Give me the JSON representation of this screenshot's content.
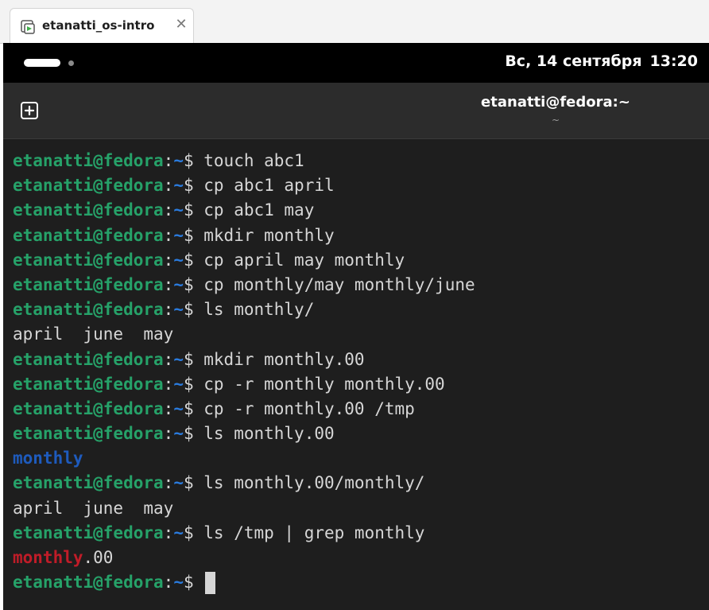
{
  "window": {
    "tab_title": "etanatti_os-intro",
    "tab_close_glyph": "✕",
    "tab_icon": "terminal-app-icon"
  },
  "topbar": {
    "clock": {
      "date": "Вс, 14 сентября",
      "time": "13:20"
    }
  },
  "headerbar": {
    "title": "etanatti@fedora:~",
    "subtitle": "~",
    "new_tab_icon": "plus-box-icon"
  },
  "prompt": {
    "user_host": "etanatti@fedora",
    "colon": ":",
    "path": "~",
    "symbol": "$ "
  },
  "terminal": {
    "lines": [
      {
        "type": "cmd",
        "text": "touch abc1"
      },
      {
        "type": "cmd",
        "text": "cp abc1 april"
      },
      {
        "type": "cmd",
        "text": "cp abc1 may"
      },
      {
        "type": "cmd",
        "text": "mkdir monthly"
      },
      {
        "type": "cmd",
        "text": "cp april may monthly"
      },
      {
        "type": "cmd",
        "text": "cp monthly/may monthly/june"
      },
      {
        "type": "cmd",
        "text": "ls monthly/"
      },
      {
        "type": "out",
        "parts": [
          {
            "text": "april  june  may",
            "style": "plain"
          }
        ]
      },
      {
        "type": "cmd",
        "text": "mkdir monthly.00"
      },
      {
        "type": "cmd",
        "text": "cp -r monthly monthly.00"
      },
      {
        "type": "cmd",
        "text": "cp -r monthly.00 /tmp"
      },
      {
        "type": "cmd",
        "text": "ls monthly.00"
      },
      {
        "type": "out",
        "parts": [
          {
            "text": "monthly",
            "style": "dir"
          }
        ]
      },
      {
        "type": "cmd",
        "text": "ls monthly.00/monthly/"
      },
      {
        "type": "out",
        "parts": [
          {
            "text": "april  june  may",
            "style": "plain"
          }
        ]
      },
      {
        "type": "cmd",
        "text": "ls /tmp | grep monthly"
      },
      {
        "type": "out",
        "parts": [
          {
            "text": "monthly",
            "style": "match"
          },
          {
            "text": ".00",
            "style": "plain"
          }
        ]
      },
      {
        "type": "cmd",
        "text": "",
        "cursor": true
      }
    ]
  },
  "colors": {
    "prompt_user": "#26a269",
    "prompt_path": "#2a7bde",
    "dir": "#1e5bbd",
    "grep_match": "#c01c28",
    "terminal_bg": "#1e1e1e",
    "headerbar_bg": "#2c2c2c"
  }
}
